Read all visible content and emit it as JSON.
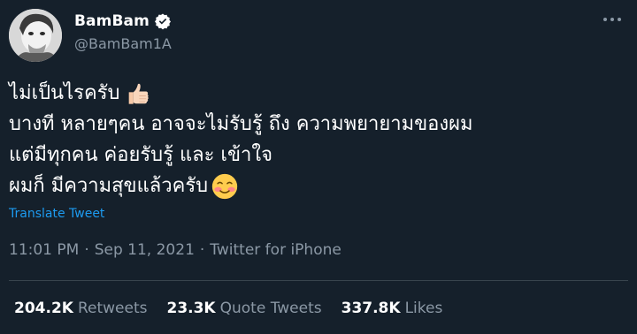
{
  "colors": {
    "background": "#15202b",
    "text": "#ffffff",
    "secondary": "#8b98a5",
    "link": "#1d9bf0",
    "divider": "#38444d"
  },
  "author": {
    "name": "BamBam",
    "handle": "@BamBam1A",
    "verified": true,
    "avatar_icon": "avatar-photo"
  },
  "menu_icon": "more-icon",
  "tweet": {
    "lines": [
      "ไม่เป็นไรครับ",
      "บางที หลายๆคน อาจจะไม่รับรู้ ถึง ความพยายามของผม",
      "แต่มีทุกคน ค่อยรับรู้ และ เข้าใจ",
      "ผมก็ มีความสุขแล้วครับ"
    ],
    "emojis": [
      "thumbs-up-icon",
      "blushing-face-icon"
    ],
    "translate_label": "Translate Tweet"
  },
  "meta": {
    "time": "11:01 PM",
    "sep1": "·",
    "date": "Sep 11, 2021",
    "sep2": "·",
    "source": "Twitter for iPhone"
  },
  "stats": {
    "retweets_count": "204.2K",
    "retweets_label": "Retweets",
    "quotes_count": "23.3K",
    "quotes_label": "Quote Tweets",
    "likes_count": "337.8K",
    "likes_label": "Likes"
  }
}
